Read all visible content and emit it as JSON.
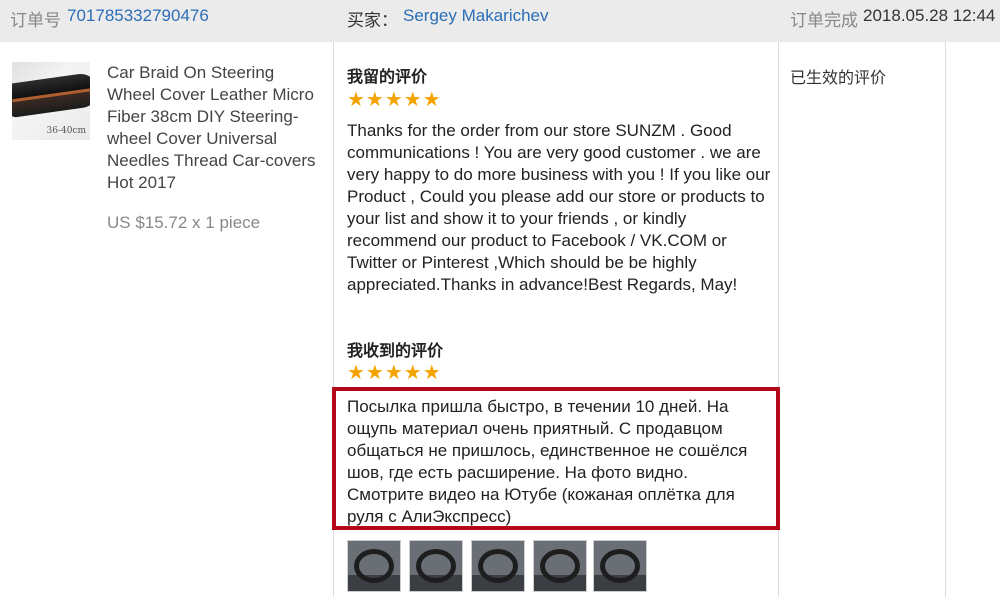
{
  "header": {
    "order_label": "订单号",
    "order_number": "701785332790476",
    "buyer_label": "买家：",
    "buyer_name": "Sergey Makarichev",
    "completed_label": "订单完成",
    "completed_time": "2018.05.28 12:44"
  },
  "product": {
    "thumb_size_label": "36-40cm",
    "title": "Car Braid On Steering Wheel Cover Leather Micro Fiber 38cm DIY Steering-wheel Cover Universal Needles Thread Car-covers Hot 2017",
    "price": "US $15.72 x 1 piece"
  },
  "my_review": {
    "title": "我留的评价",
    "stars": "★★★★★",
    "rating": 5,
    "text": "Thanks for the order from our store SUNZM . Good communications ! You are very good customer . we are very happy to do more business with you ! If you like our Product , Could you please add our store or products to your list and show it to your friends , or kindly recommend our product to Facebook / VK.COM or Twitter or Pinterest ,Which should be be highly appreciated.Thanks in advance!Best Regards, May!"
  },
  "received_review": {
    "title": "我收到的评价",
    "stars": "★★★★★",
    "rating": 5,
    "text": "Посылка пришла быстро, в течении 10 дней. На ощупь материал очень приятный. С продавцом общаться не пришлось, единственное не сошёлся шов, где есть расширение. На фото видно. Смотрите видео на Ютубе (кожаная оплётка для руля с АлиЭкспресс)",
    "photo_count": 5
  },
  "status": {
    "text": "已生效的评价"
  },
  "colors": {
    "header_bg": "#ebebeb",
    "link": "#2a6eb8",
    "star": "#f5a300",
    "highlight_border": "#b40818"
  }
}
